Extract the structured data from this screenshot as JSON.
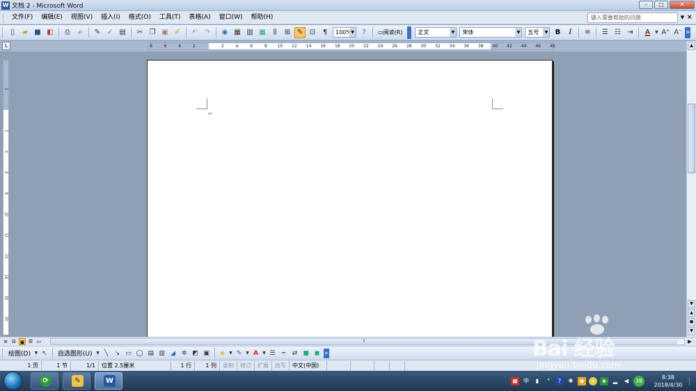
{
  "window": {
    "title": "文档 2 - Microsoft Word",
    "app_icon": "W"
  },
  "menu": {
    "items": [
      "文件(F)",
      "编辑(E)",
      "视图(V)",
      "插入(I)",
      "格式(O)",
      "工具(T)",
      "表格(A)",
      "窗口(W)",
      "帮助(H)"
    ],
    "help_placeholder": "键入需要帮助的问题",
    "close_glyph": "×"
  },
  "toolbar": {
    "zoom": "100%",
    "read_label": "阅读(R)",
    "style": "正文",
    "font": "宋体",
    "size": "五号",
    "bold": "B",
    "italic": "I",
    "font_color_label": "A"
  },
  "ruler": {
    "corner": "L",
    "h_numbers": [
      "8",
      "6",
      "4",
      "2",
      "",
      "2",
      "4",
      "6",
      "8",
      "10",
      "12",
      "14",
      "16",
      "18",
      "20",
      "22",
      "24",
      "26",
      "28",
      "30",
      "32",
      "34",
      "36",
      "38",
      "40",
      "42",
      "44",
      "46",
      "48"
    ],
    "v_numbers": [
      "2",
      "",
      "2",
      "4",
      "6",
      "8",
      "10",
      "12",
      "14",
      "16",
      "18",
      "20"
    ]
  },
  "document": {
    "paragraph_mark": "↵"
  },
  "drawing_toolbar": {
    "draw_label": "绘图(D)",
    "autoshape_label": "自选图形(U)"
  },
  "status": {
    "page": "1 页",
    "section": "1 节",
    "pages": "1/1",
    "position": "位置 2.5厘米",
    "line": "1 行",
    "column": "1 列",
    "rec": "录制",
    "trk": "修订",
    "ext": "扩展",
    "ovr": "改写",
    "language": "中文(中国)"
  },
  "taskbar": {
    "time": "8:38",
    "date": "2018/4/30",
    "badge": "38",
    "ime": "中"
  },
  "watermark": {
    "brand": "Bai  经验",
    "url": "jingyan.baidu.com"
  }
}
